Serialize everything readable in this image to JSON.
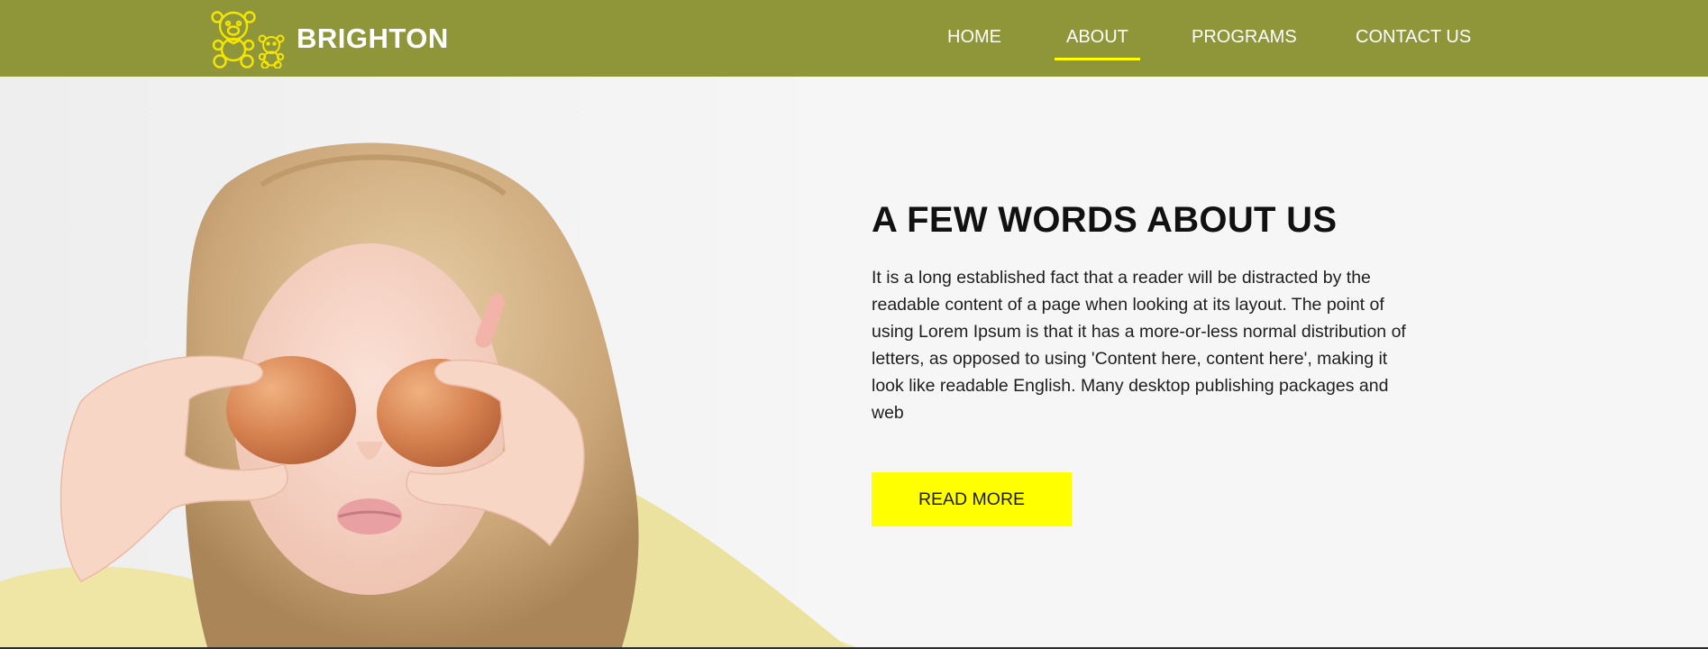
{
  "header": {
    "brand": "BRIGHTON",
    "logo_icon": "teddy-bears-icon"
  },
  "nav": {
    "items": [
      {
        "label": "HOME",
        "active": false
      },
      {
        "label": "ABOUT",
        "active": true
      },
      {
        "label": "PROGRAMS",
        "active": false
      },
      {
        "label": "CONTACT US",
        "active": false
      }
    ]
  },
  "about": {
    "title": "A FEW WORDS ABOUT US",
    "text": "It is a long established fact that a reader will be distracted by the readable content of a page when looking at its layout. The point of using Lorem Ipsum is that it has a more-or-less normal distribution of letters, as opposed to using 'Content here, content here', making it look like readable English. Many desktop publishing packages and web",
    "button_label": "READ MORE"
  },
  "colors": {
    "navbar": "#8f963a",
    "accent": "#ffff00",
    "logo": "#f5e600",
    "background": "#f6f6f6"
  }
}
